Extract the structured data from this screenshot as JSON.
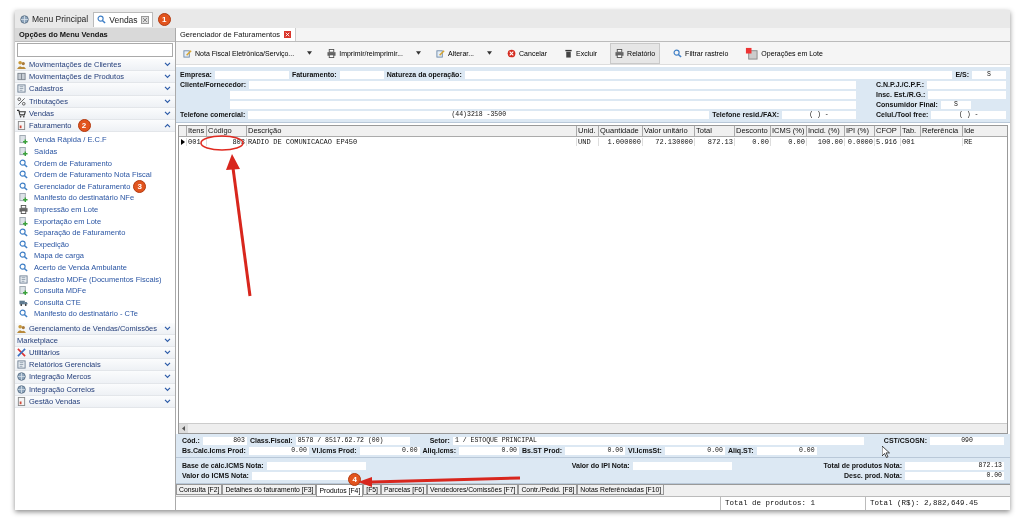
{
  "top_tabs": [
    {
      "label": "Menu Principal",
      "kind": "globe",
      "selected": false,
      "closable": false
    },
    {
      "label": "Vendas",
      "kind": "search",
      "selected": true,
      "closable": true,
      "badge": "1"
    }
  ],
  "sidebar": {
    "title": "Opções do Menu Vendas",
    "groups": [
      {
        "label": "Movimentações de Clientes",
        "kind": "people",
        "expanded": false
      },
      {
        "label": "Movimentações de Produtos",
        "kind": "box",
        "expanded": false
      },
      {
        "label": "Cadastros",
        "kind": "book",
        "expanded": false
      },
      {
        "label": "Tributações",
        "kind": "percent",
        "expanded": false
      },
      {
        "label": "Vendas",
        "kind": "cart",
        "expanded": false
      },
      {
        "label": "Faturamento",
        "kind": "invoice",
        "expanded": true,
        "badge": "2",
        "children": [
          {
            "label": "Venda Rápida / E.C.F",
            "kind": "add"
          },
          {
            "label": "Saídas",
            "kind": "add"
          },
          {
            "label": "Ordem de Faturamento",
            "kind": "search"
          },
          {
            "label": "Ordem de Faturamento Nota Fiscal",
            "kind": "search"
          },
          {
            "label": "Gerenciador de Faturamento",
            "kind": "search",
            "badge": "3"
          },
          {
            "label": "Manifesto do destinatário NFe",
            "kind": "add"
          },
          {
            "label": "Impressão em Lote",
            "kind": "print"
          },
          {
            "label": "Exportação em Lote",
            "kind": "add"
          },
          {
            "label": "Separação de Faturamento",
            "kind": "search"
          },
          {
            "label": "Expedição",
            "kind": "search"
          },
          {
            "label": "Mapa de carga",
            "kind": "search"
          },
          {
            "label": "Acerto de Venda Ambulante",
            "kind": "search"
          },
          {
            "label": "Cadastro MDFe (Documentos Fiscais)",
            "kind": "book"
          },
          {
            "label": "Consulta MDFe",
            "kind": "add"
          },
          {
            "label": "Consulta CTE",
            "kind": "truck"
          },
          {
            "label": "Manifesto do destinatário - CTe",
            "kind": "search"
          }
        ]
      },
      {
        "label": "Gerenciamento de Vendas/Comissões",
        "kind": "people",
        "expanded": false
      },
      {
        "label": "Marketplace",
        "kind": "none",
        "expanded": false
      },
      {
        "label": "Utilitários",
        "kind": "tools",
        "expanded": false
      },
      {
        "label": "Relatórios Gerenciais",
        "kind": "book",
        "expanded": false
      },
      {
        "label": "Integração Mercos",
        "kind": "globe",
        "expanded": false
      },
      {
        "label": "Integração Correios",
        "kind": "globe",
        "expanded": false
      },
      {
        "label": "Gestão Vendas",
        "kind": "invoice",
        "expanded": false
      }
    ]
  },
  "document_tab": {
    "label": "Gerenciador de Faturamentos"
  },
  "toolbar": [
    {
      "label": "Nota Fiscal Eletrônica/Serviço...",
      "kind": "edit",
      "dropdown": true,
      "pressed": false
    },
    {
      "label": "Imprimir/reimprimir...",
      "kind": "print",
      "dropdown": true,
      "pressed": false
    },
    {
      "label": "Alterar...",
      "kind": "edit",
      "dropdown": true,
      "pressed": false
    },
    {
      "label": "Cancelar",
      "kind": "cancel",
      "dropdown": false,
      "pressed": false
    },
    {
      "label": "Excluir",
      "kind": "trash",
      "dropdown": false,
      "pressed": false
    },
    {
      "label": "Relatório",
      "kind": "print",
      "dropdown": false,
      "pressed": true
    },
    {
      "label": "Filtrar rastreio",
      "kind": "search",
      "dropdown": false,
      "pressed": false
    },
    {
      "label": "Operações em Lote",
      "kind": "batch",
      "dropdown": false,
      "pressed": false
    }
  ],
  "header": {
    "empresa": {
      "label": "Empresa:"
    },
    "faturamento": {
      "label": "Faturamento:"
    },
    "natureza": {
      "label": "Natureza da operação:"
    },
    "es": {
      "label": "E/S:",
      "value": "S"
    },
    "cliente": {
      "label": "Cliente/Fornecedor:"
    },
    "cnpj": {
      "label": "C.N.P.J./C.P.F.:"
    },
    "insc": {
      "label": "Insc. Est./R.G.:"
    },
    "consumidor": {
      "label": "Consumidor Final:",
      "value": "S"
    },
    "telefone_comercial": {
      "label": "Telefone comercial:",
      "value": "(44)3218 -3500"
    },
    "telefone_resid": {
      "label": "Telefone resid./FAX:",
      "value": "(  )      -"
    },
    "celular": {
      "label": "Celul./Tool free:",
      "value": "(  )      -"
    }
  },
  "table": {
    "columns": [
      "Itens",
      "Código",
      "Descrição",
      "Unid.",
      "Quantidade",
      "Valor unitário",
      "Total",
      "Desconto",
      "ICMS (%)",
      "Incid. (%)",
      "IPI (%)",
      "CFOP",
      "Tab.",
      "Referência",
      "Ide"
    ],
    "rows": [
      {
        "selected": true,
        "cells": [
          "001",
          "803",
          "RADIO DE COMUNICACAO EP450",
          "UND",
          "1.000000",
          "72.130000",
          "872.13",
          "0.00",
          "0.00",
          "100.00",
          "0.0000",
          "5.916",
          "001",
          "",
          "RE"
        ]
      }
    ]
  },
  "product_panel": {
    "cod": {
      "label": "Cód.:",
      "value": "803"
    },
    "class_fiscal": {
      "label": "Class.Fiscal:",
      "value": "8578 / 8517.62.72 (00)"
    },
    "setor": {
      "label": "Setor:",
      "value": "1 / ESTOQUE PRINCIPAL"
    },
    "cst": {
      "label": "CST/CSOSN:",
      "value": "090"
    },
    "taxes": [
      {
        "label": "Bs.Calc.Icms Prod:",
        "value": "0.00"
      },
      {
        "label": "Vl.Icms Prod:",
        "value": "0.00"
      },
      {
        "label": "Aliq.Icms:",
        "value": "0.00"
      },
      {
        "label": "Bs.ST Prod:",
        "value": "0.00"
      },
      {
        "label": "Vl.IcmsSt:",
        "value": "0.00"
      },
      {
        "label": "Aliq.ST:",
        "value": "0.00"
      }
    ]
  },
  "totals": {
    "base_icms": {
      "label": "Base de cálc.ICMS Nota:"
    },
    "valor_icms": {
      "label": "Valor do ICMS Nota:"
    },
    "valor_ipi": {
      "label": "Valor do IPI Nota:"
    },
    "total_produtos": {
      "label": "Total de produtos Nota:",
      "value": "872.13"
    },
    "desc_prod": {
      "label": "Desc. prod. Nota:",
      "value": "0.00"
    }
  },
  "bottom_tabs": [
    {
      "label": "Consulta [F2]",
      "selected": false
    },
    {
      "label": "Detalhes do faturamento [F3]",
      "selected": false
    },
    {
      "label": "Produtos [F4]",
      "selected": true,
      "badge": "4"
    },
    {
      "label": "[F5]",
      "selected": false
    },
    {
      "label": "Parcelas [F6]",
      "selected": false
    },
    {
      "label": "Vendedores/Comissões [F7]",
      "selected": false
    },
    {
      "label": "Contr./Pedid. [F8]",
      "selected": false
    },
    {
      "label": "Notas Referênciadas [F10]",
      "selected": false
    }
  ],
  "status_bar": [
    "Total de produtos: 1",
    "Total (R$): 2,882,649.45"
  ]
}
